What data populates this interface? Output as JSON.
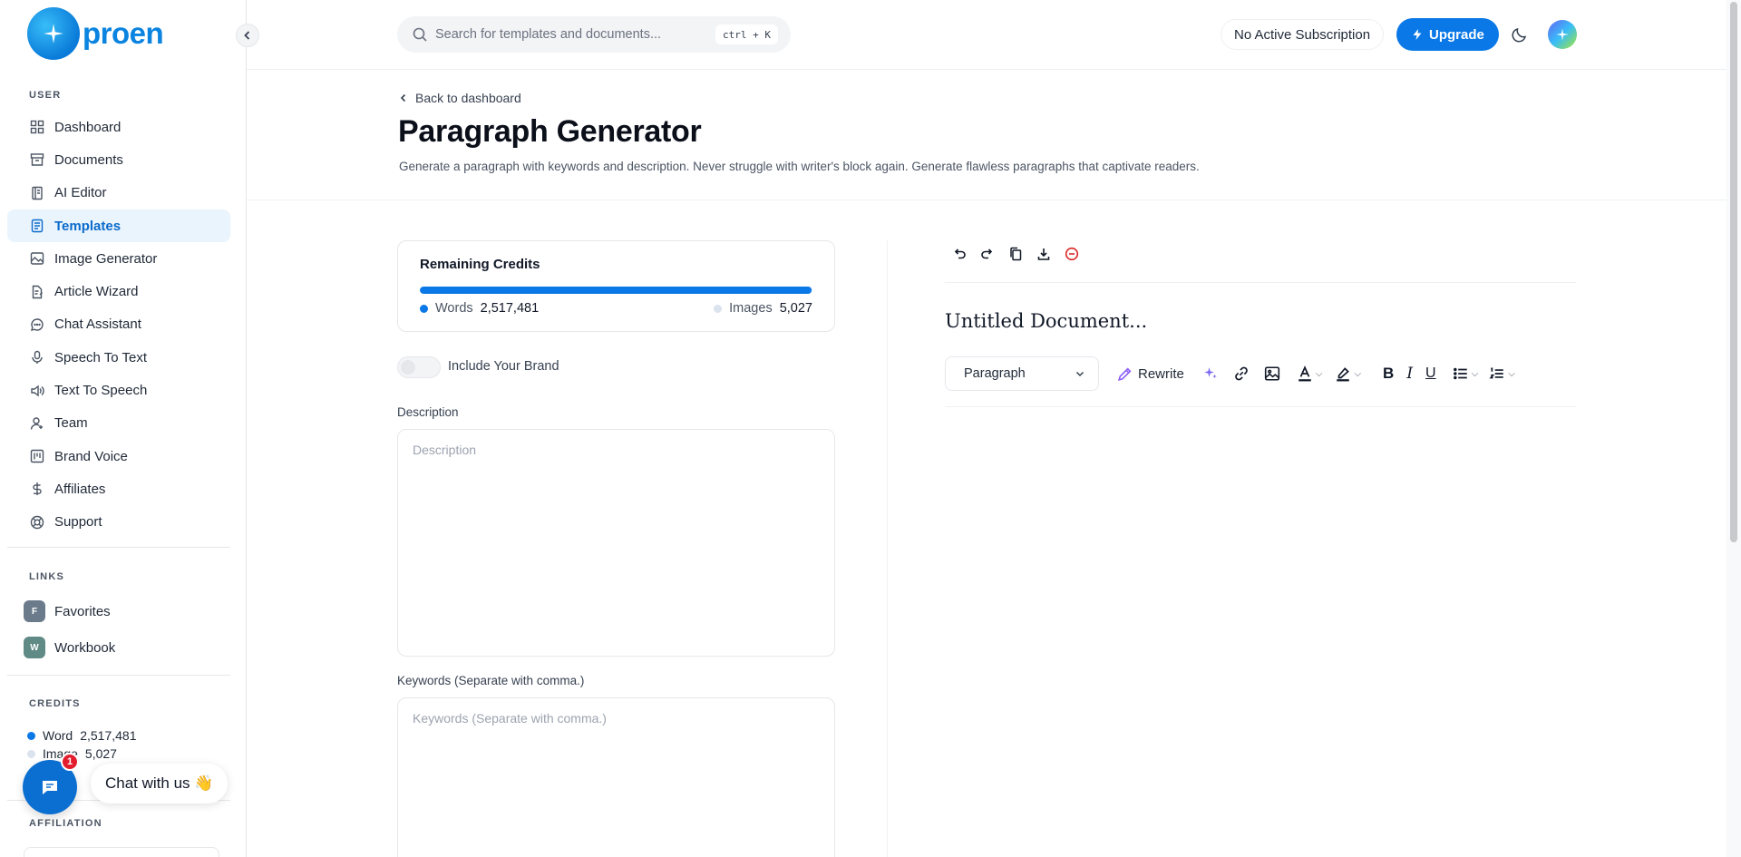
{
  "brand": {
    "name": "proen"
  },
  "sidebar": {
    "user_label": "USER",
    "items": [
      {
        "label": "Dashboard",
        "icon": "grid-icon"
      },
      {
        "label": "Documents",
        "icon": "archive-icon"
      },
      {
        "label": "AI Editor",
        "icon": "notebook-icon"
      },
      {
        "label": "Templates",
        "icon": "template-icon",
        "active": true
      },
      {
        "label": "Image Generator",
        "icon": "image-icon"
      },
      {
        "label": "Article Wizard",
        "icon": "file-pen-icon"
      },
      {
        "label": "Chat Assistant",
        "icon": "chat-bubble-icon"
      },
      {
        "label": "Speech To Text",
        "icon": "mic-icon"
      },
      {
        "label": "Text To Speech",
        "icon": "speaker-icon"
      },
      {
        "label": "Team",
        "icon": "user-plus-icon"
      },
      {
        "label": "Brand Voice",
        "icon": "brand-voice-icon"
      },
      {
        "label": "Affiliates",
        "icon": "dollar-icon"
      },
      {
        "label": "Support",
        "icon": "lifebuoy-icon"
      }
    ],
    "links_label": "LINKS",
    "links": [
      {
        "badge": "F",
        "label": "Favorites",
        "color": "#6b7b8c"
      },
      {
        "badge": "W",
        "label": "Workbook",
        "color": "#5f8a85"
      }
    ],
    "credits_label": "CREDITS",
    "credits": {
      "word_label": "Word",
      "word_value": "2,517,481",
      "image_label": "Image",
      "image_value": "5,027"
    },
    "affiliation_label": "AFFILIATION"
  },
  "chat_widget": {
    "label": "Chat with us 👋",
    "badge": "1"
  },
  "topbar": {
    "search_placeholder": "Search for templates and documents...",
    "shortcut": "ctrl + K",
    "subscription": "No Active Subscription",
    "upgrade": "Upgrade"
  },
  "header": {
    "back": "Back to dashboard",
    "title": "Paragraph Generator",
    "description": "Generate a paragraph with keywords and description. Never struggle with writer's block again. Generate flawless paragraphs that captivate readers."
  },
  "form": {
    "credits_title": "Remaining Credits",
    "credits_fill": 0.998,
    "words_label": "Words",
    "words_value": "2,517,481",
    "images_label": "Images",
    "images_value": "5,027",
    "brand_toggle": "Include Your Brand",
    "description_label": "Description",
    "description_placeholder": "Description",
    "keywords_label": "Keywords (Separate with comma.)",
    "keywords_placeholder": "Keywords (Separate with comma.)"
  },
  "editor": {
    "doc_title": "Untitled Document...",
    "block_type": "Paragraph",
    "rewrite": "Rewrite"
  },
  "colors": {
    "accent": "#0a78e6",
    "brand": "#0a84e0",
    "danger": "#e11d2e"
  }
}
